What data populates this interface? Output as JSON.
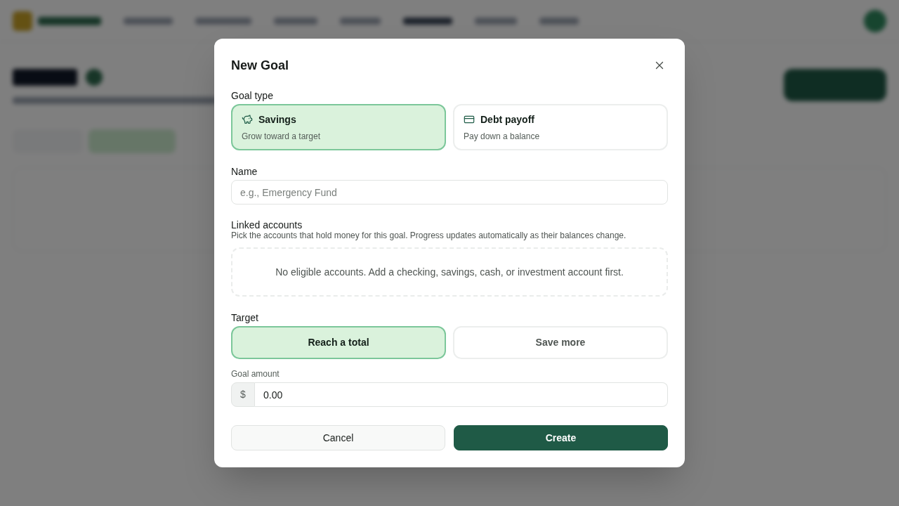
{
  "dialog": {
    "title": "New Goal"
  },
  "goal_type": {
    "label": "Goal type",
    "options": [
      {
        "kind": "savings",
        "title": "Savings",
        "description": "Grow toward a target",
        "selected": true
      },
      {
        "kind": "debt",
        "title": "Debt payoff",
        "description": "Pay down a balance",
        "selected": false
      }
    ]
  },
  "name_field": {
    "label": "Name",
    "placeholder": "e.g., Emergency Fund"
  },
  "linked_accounts": {
    "label": "Linked accounts",
    "description": "Pick the accounts that hold money for this goal. Progress updates automatically as their balances change.",
    "empty_message": "No eligible accounts. Add a checking, savings, cash, or investment account first."
  },
  "target": {
    "label": "Target",
    "options": [
      {
        "label": "Reach a total",
        "selected": true
      },
      {
        "label": "Save more",
        "selected": false
      }
    ]
  },
  "goal_amount": {
    "label": "Goal amount",
    "prefix": "$",
    "value": "0.00"
  },
  "buttons": [
    {
      "kind": "secondary",
      "label": "Cancel"
    },
    {
      "kind": "primary",
      "label": "Create"
    }
  ]
}
